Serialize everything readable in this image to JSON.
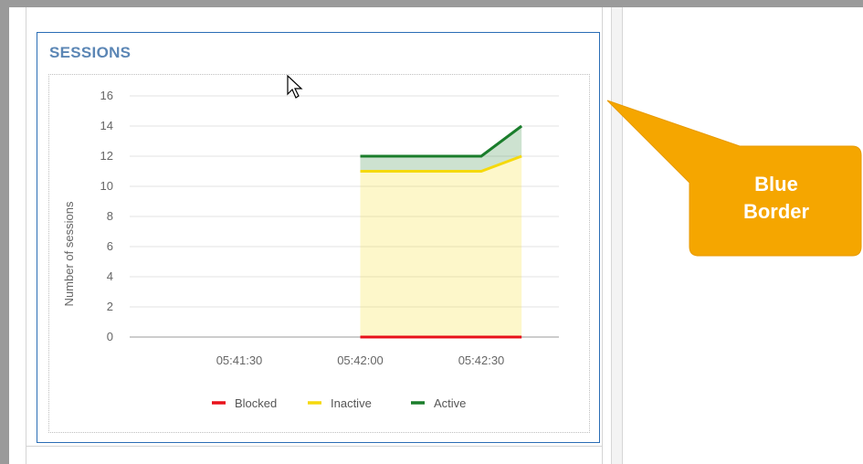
{
  "card": {
    "title": "SESSIONS"
  },
  "callout": {
    "line1": "Blue",
    "line2": "Border",
    "color": "#f5a600"
  },
  "colors": {
    "card_border": "#2a6db5",
    "title": "#5b86b5",
    "blocked": "#e8111a",
    "inactive": "#f5d90c",
    "active": "#1a7d2b"
  },
  "chart_data": {
    "type": "area",
    "title": "",
    "xlabel": "",
    "ylabel": "Number of sessions",
    "ylim": [
      0,
      16
    ],
    "yticks": [
      "0",
      "2",
      "4",
      "6",
      "8",
      "10",
      "12",
      "14",
      "16"
    ],
    "xticks": [
      "05:41:30",
      "05:42:00",
      "05:42:30"
    ],
    "x": [
      "05:42:00",
      "05:42:30",
      "05:42:40"
    ],
    "stacked": true,
    "grid": true,
    "legend": "bottom",
    "series": [
      {
        "name": "Blocked",
        "color": "#e8111a",
        "values": [
          0,
          0,
          0
        ]
      },
      {
        "name": "Inactive",
        "color": "#f5d90c",
        "values": [
          11,
          11,
          12
        ]
      },
      {
        "name": "Active",
        "color": "#1a7d2b",
        "values": [
          1,
          1,
          2
        ]
      }
    ]
  }
}
